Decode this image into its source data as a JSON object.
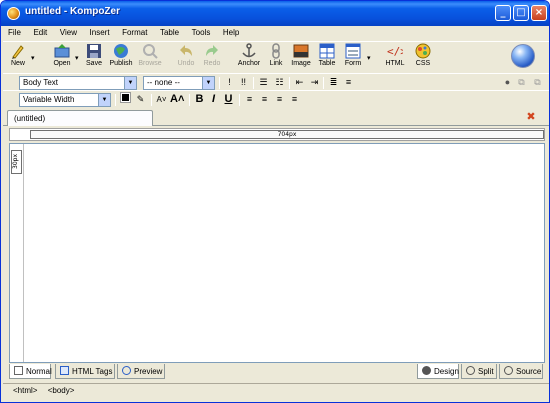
{
  "window": {
    "title": "untitled - KompoZer"
  },
  "menu": [
    "File",
    "Edit",
    "View",
    "Insert",
    "Format",
    "Table",
    "Tools",
    "Help"
  ],
  "toolbar": {
    "new": "New",
    "open": "Open",
    "save": "Save",
    "publish": "Publish",
    "browse": "Browse",
    "undo": "Undo",
    "redo": "Redo",
    "anchor": "Anchor",
    "link": "Link",
    "image": "Image",
    "table": "Table",
    "form": "Form",
    "html": "HTML",
    "css": "CSS"
  },
  "format1": {
    "paragraph_style": "Body Text",
    "class_style": "-- none --"
  },
  "format2": {
    "font": "Variable Width",
    "bold": "B",
    "italic": "I",
    "underline": "U"
  },
  "tabs": {
    "document": "(untitled)"
  },
  "ruler": {
    "width_label": "704px",
    "height_label": "30px"
  },
  "bottom_tabs": {
    "normal": "Normal",
    "html_tags": "HTML Tags",
    "preview": "Preview",
    "design": "Design",
    "split": "Split",
    "source": "Source"
  },
  "status": {
    "tags": [
      "<html>",
      "<body>"
    ]
  },
  "colors": {
    "titlebar": "#0A5FE9",
    "chrome": "#ECE9D8",
    "close_red": "#D2451E"
  }
}
